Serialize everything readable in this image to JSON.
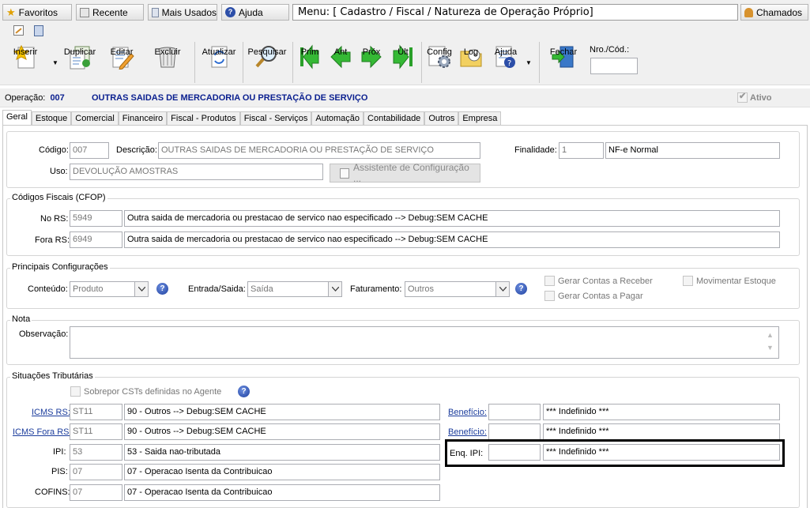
{
  "topbar": {
    "favoritos": "Favoritos",
    "recente": "Recente",
    "mais_usados": "Mais Usados",
    "ajuda": "Ajuda",
    "menu": "Menu: [ Cadastro / Fiscal / Natureza de Operação Próprio]",
    "chamados": "Chamados"
  },
  "toolbar": {
    "inserir": "Inserir",
    "duplicar": "Duplicar",
    "editar": "Editar",
    "excluir": "Excluir",
    "atualizar": "Atualizar",
    "pesquisar": "Pesquisar",
    "prim": "Prim",
    "ant": "Ant",
    "prox": "Próx",
    "ult": "Últ",
    "config": "Config",
    "log": "Log",
    "ajuda": "Ajuda",
    "fechar": "Fechar",
    "nro_cod_label": "Nro./Cód.:",
    "nro_cod_value": ""
  },
  "operacao": {
    "label": "Operação:",
    "code": "007",
    "desc": "OUTRAS SAIDAS DE MERCADORIA OU PRESTAÇÃO DE SERVIÇO",
    "ativo": "Ativo"
  },
  "tabs": [
    "Geral",
    "Estoque",
    "Comercial",
    "Financeiro",
    "Fiscal - Produtos",
    "Fiscal - Serviços",
    "Automação",
    "Contabilidade",
    "Outros",
    "Empresa"
  ],
  "geral": {
    "codigo_label": "Código:",
    "codigo": "007",
    "descricao_label": "Descrição:",
    "descricao": "OUTRAS SAIDAS DE MERCADORIA OU PRESTAÇÃO DE SERVIÇO",
    "finalidade_label": "Finalidade:",
    "finalidade_code": "1",
    "finalidade_desc": "NF-e Normal",
    "uso_label": "Uso:",
    "uso": "DEVOLUÇÃO AMOSTRAS",
    "assistente": "Assistente de Configuração ..."
  },
  "cfop": {
    "legend": "Códigos Fiscais (CFOP)",
    "no_rs_label": "No RS:",
    "no_rs_code": "5949",
    "no_rs_desc": "Outra saida de mercadoria ou prestacao de servico nao especificado   --> Debug:SEM CACHE",
    "fora_rs_label": "Fora RS:",
    "fora_rs_code": "6949",
    "fora_rs_desc": "Outra saida de mercadoria ou prestacao de servico nao especificado   --> Debug:SEM CACHE"
  },
  "config": {
    "legend": "Principais Configurações",
    "conteudo_label": "Conteúdo:",
    "conteudo": "Produto",
    "entrada_label": "Entrada/Saida:",
    "entrada": "Saída",
    "faturamento_label": "Faturamento:",
    "faturamento": "Outros",
    "gerar_receber": "Gerar Contas a Receber",
    "gerar_pagar": "Gerar Contas a Pagar",
    "movimentar": "Movimentar Estoque"
  },
  "nota": {
    "legend": "Nota",
    "obs_label": "Observação:",
    "obs": ""
  },
  "situacoes": {
    "legend": "Situações Tributárias",
    "sobrepor": "Sobrepor CSTs definidas no Agente",
    "icms_rs_label": "ICMS RS:",
    "icms_rs_code": "ST11",
    "icms_rs_desc": "90 - Outros   --> Debug:SEM CACHE",
    "icms_fora_label": "ICMS Fora RS:",
    "icms_fora_code": "ST11",
    "icms_fora_desc": "90 - Outros   --> Debug:SEM CACHE",
    "ipi_label": "IPI:",
    "ipi_code": "53",
    "ipi_desc": "53 - Saida nao-tributada",
    "pis_label": "PIS:",
    "pis_code": "07",
    "pis_desc": "07 - Operacao Isenta da Contribuicao",
    "cofins_label": "COFINS:",
    "cofins_code": "07",
    "cofins_desc": "07 - Operacao Isenta da Contribuicao",
    "beneficio1_label": "Benefício:",
    "beneficio1_code": "",
    "beneficio1_desc": "*** Indefinido ***",
    "beneficio2_label": "Benefício:",
    "beneficio2_code": "",
    "beneficio2_desc": "*** Indefinido ***",
    "enq_ipi_label": "Enq. IPI:",
    "enq_ipi_code": "",
    "enq_ipi_desc": "*** Indefinido ***"
  },
  "colors": {
    "operacao_blue": "#0a1f8f",
    "link_blue": "#1b3c9c",
    "highlight_border": "#000000"
  }
}
